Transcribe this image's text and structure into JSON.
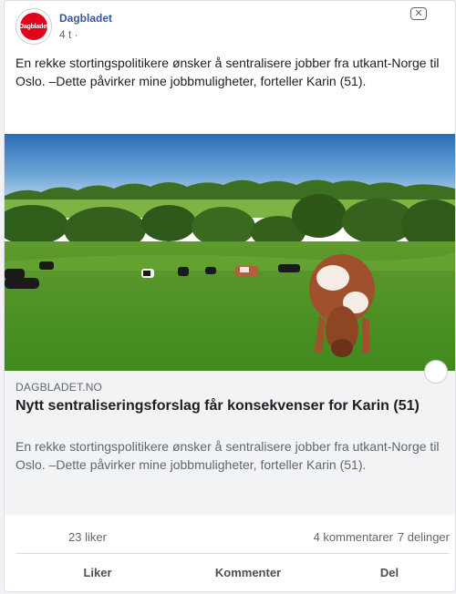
{
  "post": {
    "page_name": "Dagbladet",
    "time": "4 t ·",
    "avatar_text": "Dagbladet",
    "text": "En rekke stortingspolitikere ønsker å sentralisere jobber fra utkant-Norge til Oslo. –Dette påvirker mine jobbmuligheter, forteller Karin (51)."
  },
  "link": {
    "domain": "DAGBLADET.NO",
    "title": "Nytt sentraliseringsforslag får konsekvenser for Karin (51)",
    "description": "En rekke stortingspolitikere ønsker å sentralisere jobber fra utkant-Norge til Oslo. –Dette påvirker mine jobbmuligheter, forteller Karin (51)."
  },
  "stats": {
    "likes": "23 liker",
    "comments": "4 kommentarer",
    "shares": "7 delinger"
  },
  "actions": {
    "like": "Liker",
    "comment": "Kommenter",
    "share": "Del"
  },
  "icons": {
    "close": "close-icon"
  },
  "colors": {
    "brand_red": "#e3001b",
    "link_blue": "#385898"
  }
}
